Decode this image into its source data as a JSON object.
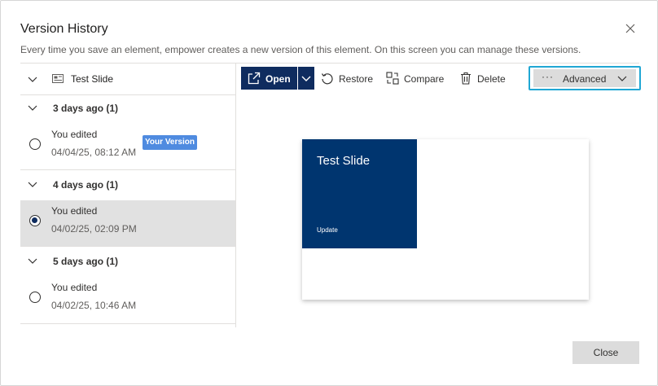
{
  "dialog": {
    "title": "Version History",
    "subtitle": "Every time you save an element, empower creates a new version of this element. On this screen you can manage these versions.",
    "close_icon": "close-icon"
  },
  "tree": {
    "root_label": "Test Slide",
    "groups": [
      {
        "label": "3 days ago (1)",
        "items": [
          {
            "who": "You edited",
            "when": "04/04/25, 08:12 AM",
            "badge": "Your Version",
            "selected": false
          }
        ]
      },
      {
        "label": "4 days ago (1)",
        "items": [
          {
            "who": "You edited",
            "when": "04/02/25, 02:09 PM",
            "selected": true
          }
        ]
      },
      {
        "label": "5 days ago (1)",
        "items": [
          {
            "who": "You edited",
            "when": "04/02/25, 10:46 AM",
            "selected": false
          }
        ]
      }
    ]
  },
  "toolbar": {
    "open_label": "Open",
    "restore_label": "Restore",
    "compare_label": "Compare",
    "delete_label": "Delete",
    "advanced_dots": "···",
    "advanced_label": "Advanced"
  },
  "preview": {
    "slide_title": "Test Slide",
    "slide_subtitle": "Update"
  },
  "footer": {
    "close_label": "Close"
  },
  "colors": {
    "primary": "#0f2c5f",
    "slide": "#00356f",
    "focus": "#20a7d4",
    "badge": "#4f8be0",
    "selected_row": "#e1e1e1"
  }
}
